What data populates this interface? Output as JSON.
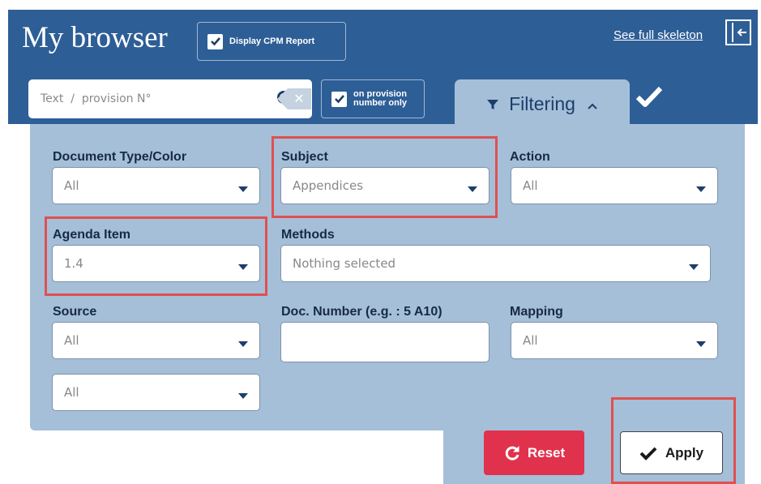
{
  "header": {
    "title": "My browser",
    "cpm_report_label": "Display CPM Report",
    "skeleton_link": "See full skeleton"
  },
  "search": {
    "placeholder": "Text  /  provision N°",
    "provision_only_label": "on provision\nnumber only"
  },
  "filter_tab": {
    "label": "Filtering"
  },
  "filters": {
    "document_type": {
      "label": "Document Type/Color",
      "value": "All"
    },
    "subject": {
      "label": "Subject",
      "value": "Appendices"
    },
    "action": {
      "label": "Action",
      "value": "All"
    },
    "agenda_item": {
      "label": "Agenda Item",
      "value": "1.4"
    },
    "methods": {
      "label": "Methods",
      "value": "Nothing selected"
    },
    "source": {
      "label": "Source",
      "value": "All",
      "value2": "All"
    },
    "doc_number": {
      "label": "Doc. Number (e.g. : 5 A10)",
      "value": ""
    },
    "mapping": {
      "label": "Mapping",
      "value": "All"
    }
  },
  "buttons": {
    "reset": "Reset",
    "apply": "Apply"
  },
  "colors": {
    "header_bg": "#2e5e96",
    "panel_bg": "#a5bfd8",
    "reset_bg": "#e0324d",
    "highlight": "#e05050"
  }
}
